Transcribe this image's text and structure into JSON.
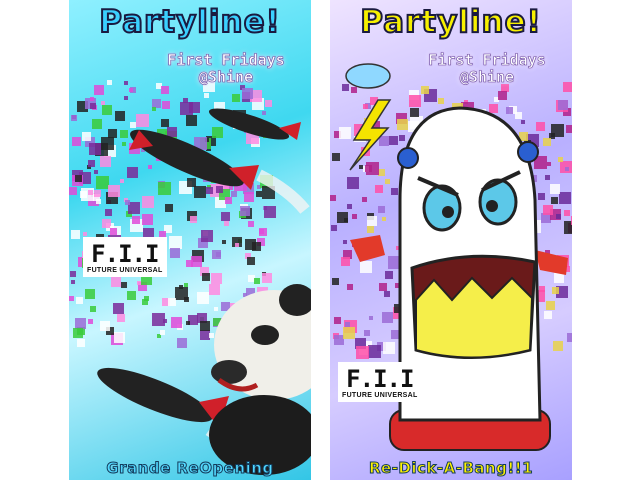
{
  "posters": [
    {
      "title": "Partyline!",
      "subtitle_line1": "First Fridays",
      "subtitle_line2": "@Shine",
      "logo_mark": "F.I.I",
      "logo_text": "FUTURE UNIVERSAL",
      "bottom": "Grande ReOpening",
      "title_color": "#3ad0ff",
      "bottom_color": "#52d8ff"
    },
    {
      "title": "Partyline!",
      "subtitle_line1": "First Fridays",
      "subtitle_line2": "@Shine",
      "logo_mark": "F.I.I",
      "logo_text": "FUTURE UNIVERSAL",
      "bottom": "Re-Dick-A-Bang!!1",
      "title_color": "#f7f000",
      "bottom_color": "#fff200"
    }
  ]
}
